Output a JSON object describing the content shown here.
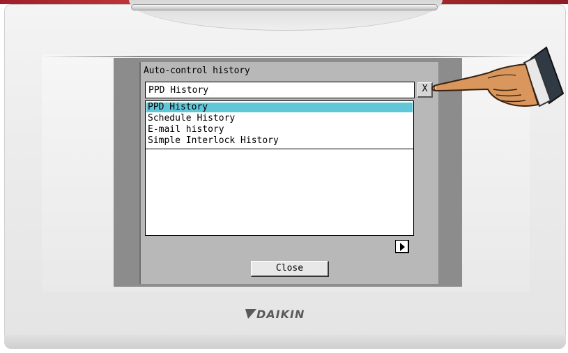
{
  "dialog": {
    "title": "Auto-control history",
    "combo": {
      "value": "PPD History",
      "button_label": "X"
    },
    "dropdown": {
      "options": [
        {
          "label": "PPD History",
          "selected": true
        },
        {
          "label": "Schedule History",
          "selected": false
        },
        {
          "label": "E-mail history",
          "selected": false
        },
        {
          "label": "Simple Interlock History",
          "selected": false
        }
      ]
    },
    "scroll_icon": "triangle-right-icon",
    "close_label": "Close"
  },
  "brand": {
    "name": "DAIKIN",
    "color": "#5a5a5a"
  },
  "colors": {
    "selection": "#5fc7d7",
    "screen_background": "#b8b8b8",
    "rim": "#a62a2a"
  },
  "pointer_icon": "pointing-hand-icon"
}
